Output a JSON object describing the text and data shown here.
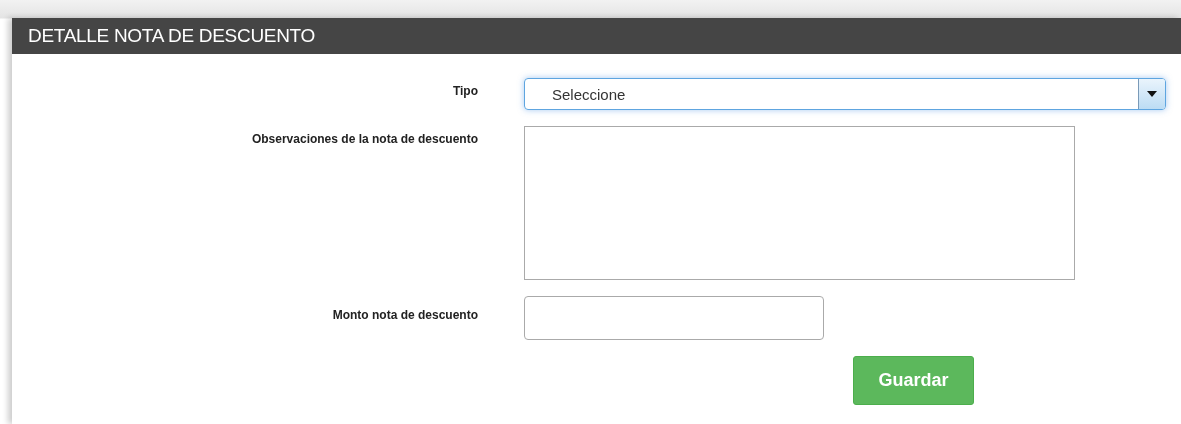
{
  "panel": {
    "title": "DETALLE NOTA DE DESCUENTO"
  },
  "fields": [
    {
      "kind": "select",
      "label": "Tipo",
      "value": "Seleccione",
      "focused": true
    },
    {
      "kind": "textarea",
      "label": "Observaciones de la nota de descuento",
      "focused": false
    },
    {
      "kind": "input",
      "label": "Monto nota de descuento",
      "focused": false
    }
  ],
  "button": {
    "label": "Guardar"
  }
}
